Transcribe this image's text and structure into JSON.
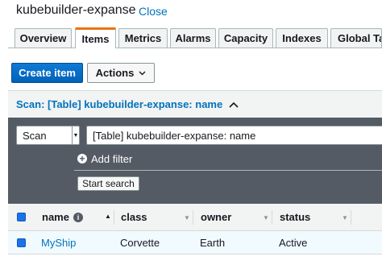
{
  "header": {
    "title": "kubebuilder-expanse",
    "close_label": "Close"
  },
  "tabs": [
    {
      "label": "Overview",
      "active": false
    },
    {
      "label": "Items",
      "active": true
    },
    {
      "label": "Metrics",
      "active": false
    },
    {
      "label": "Alarms",
      "active": false
    },
    {
      "label": "Capacity",
      "active": false
    },
    {
      "label": "Indexes",
      "active": false
    },
    {
      "label": "Global Tab",
      "active": false
    }
  ],
  "toolbar": {
    "create_label": "Create item",
    "actions_label": "Actions"
  },
  "scan": {
    "header_label": "Scan: [Table] kubebuilder-expanse: name",
    "mode_value": "Scan",
    "target_value": "[Table] kubebuilder-expanse: name",
    "add_filter_label": "Add filter",
    "start_search_label": "Start search"
  },
  "table": {
    "columns": [
      "name",
      "class",
      "owner",
      "status"
    ],
    "rows": [
      {
        "name": "MyShip",
        "class": "Corvette",
        "owner": "Earth",
        "status": "Active",
        "selected": true
      }
    ]
  },
  "colors": {
    "accent": "#ec7211",
    "primary": "#0972d3",
    "link": "#0073bb",
    "panel": "#545b64"
  },
  "icons": [
    "chevron-down-icon",
    "chevron-up-icon",
    "plus-circle-icon",
    "info-icon",
    "sort-caret-icon",
    "checkbox-icon"
  ]
}
